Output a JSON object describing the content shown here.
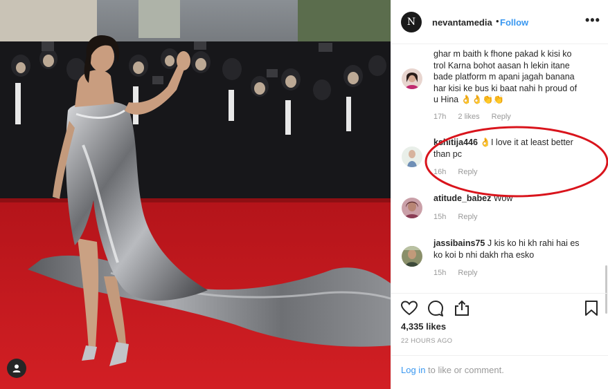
{
  "header": {
    "username": "nevantamedia",
    "separator": "•",
    "follow_label": "Follow",
    "more_label": "•••",
    "brand_letter": "N"
  },
  "comments": [
    {
      "username": "",
      "text_lines": [
        "ghar m baith k fhone pakad k kisi ko",
        "trol Karna bohot aasan h lekin itane",
        "bade platform m apani jagah banana",
        "har kisi ke bus ki baat nahi h proud of",
        "u Hina 👌👌👏👏"
      ],
      "age": "17h",
      "likes": "2 likes",
      "reply": "Reply"
    },
    {
      "username": "kshitija446",
      "text_lines": [
        "👌I love it at least better",
        "than pc"
      ],
      "age": "16h",
      "likes": "",
      "reply": "Reply"
    },
    {
      "username": "atitude_babez",
      "text_lines": [
        "Wow"
      ],
      "age": "15h",
      "likes": "",
      "reply": "Reply"
    },
    {
      "username": "jassibains75",
      "text_lines": [
        "J kis ko hi kh rahi hai es",
        "ko koi b nhi dakh rha esko"
      ],
      "age": "15h",
      "likes": "",
      "reply": "Reply"
    }
  ],
  "actions": {
    "likes": "4,335 likes",
    "time": "22 HOURS AGO"
  },
  "login": {
    "link": "Log in",
    "rest": "to like or comment."
  },
  "colors": {
    "link_blue": "#3897f0",
    "annotation_red": "#d9141c",
    "carpet_red": "#c4161c"
  },
  "icons": [
    "heart-icon",
    "comment-icon",
    "share-icon",
    "bookmark-icon",
    "user-tag-icon"
  ]
}
